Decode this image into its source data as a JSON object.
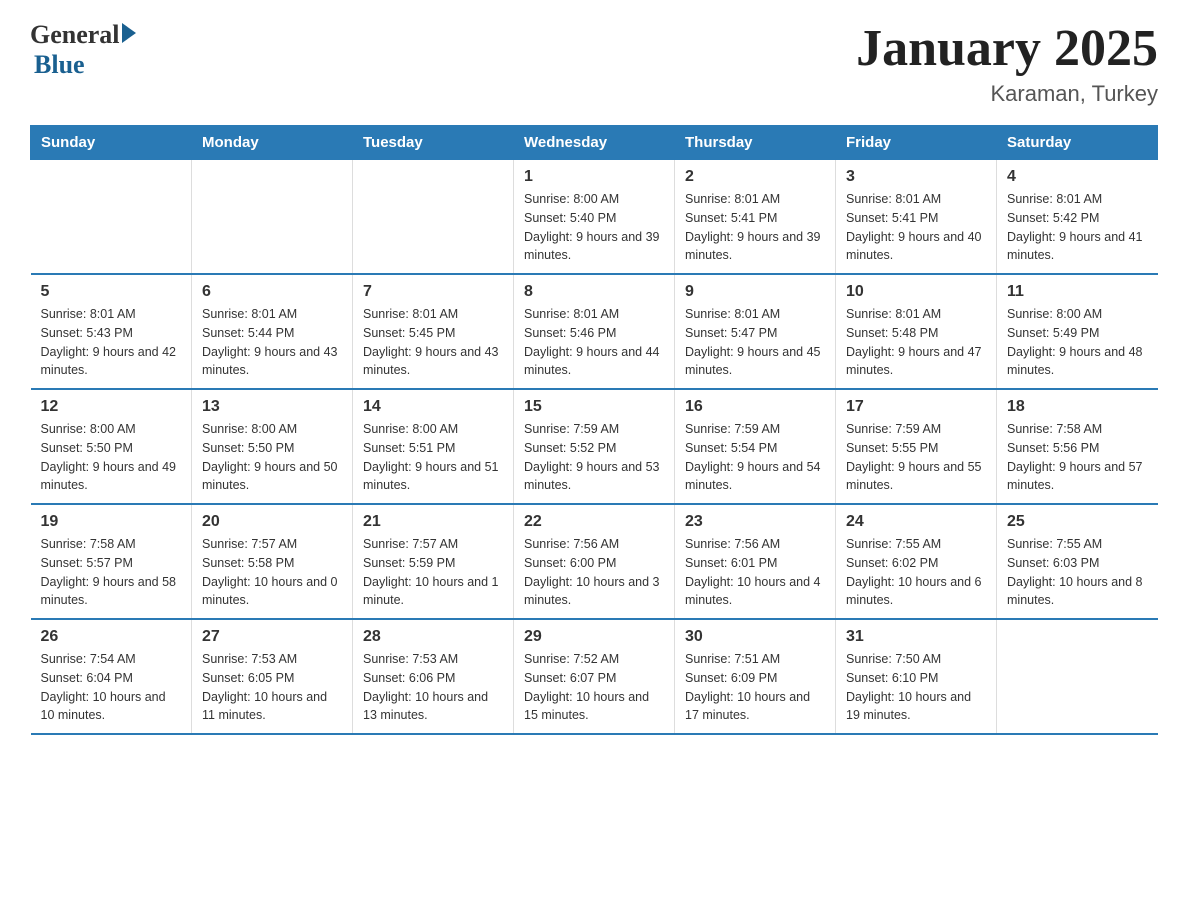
{
  "logo": {
    "general": "General",
    "blue": "Blue"
  },
  "title": "January 2025",
  "subtitle": "Karaman, Turkey",
  "weekdays": [
    "Sunday",
    "Monday",
    "Tuesday",
    "Wednesday",
    "Thursday",
    "Friday",
    "Saturday"
  ],
  "weeks": [
    [
      {
        "day": "",
        "info": ""
      },
      {
        "day": "",
        "info": ""
      },
      {
        "day": "",
        "info": ""
      },
      {
        "day": "1",
        "info": "Sunrise: 8:00 AM\nSunset: 5:40 PM\nDaylight: 9 hours and 39 minutes."
      },
      {
        "day": "2",
        "info": "Sunrise: 8:01 AM\nSunset: 5:41 PM\nDaylight: 9 hours and 39 minutes."
      },
      {
        "day": "3",
        "info": "Sunrise: 8:01 AM\nSunset: 5:41 PM\nDaylight: 9 hours and 40 minutes."
      },
      {
        "day": "4",
        "info": "Sunrise: 8:01 AM\nSunset: 5:42 PM\nDaylight: 9 hours and 41 minutes."
      }
    ],
    [
      {
        "day": "5",
        "info": "Sunrise: 8:01 AM\nSunset: 5:43 PM\nDaylight: 9 hours and 42 minutes."
      },
      {
        "day": "6",
        "info": "Sunrise: 8:01 AM\nSunset: 5:44 PM\nDaylight: 9 hours and 43 minutes."
      },
      {
        "day": "7",
        "info": "Sunrise: 8:01 AM\nSunset: 5:45 PM\nDaylight: 9 hours and 43 minutes."
      },
      {
        "day": "8",
        "info": "Sunrise: 8:01 AM\nSunset: 5:46 PM\nDaylight: 9 hours and 44 minutes."
      },
      {
        "day": "9",
        "info": "Sunrise: 8:01 AM\nSunset: 5:47 PM\nDaylight: 9 hours and 45 minutes."
      },
      {
        "day": "10",
        "info": "Sunrise: 8:01 AM\nSunset: 5:48 PM\nDaylight: 9 hours and 47 minutes."
      },
      {
        "day": "11",
        "info": "Sunrise: 8:00 AM\nSunset: 5:49 PM\nDaylight: 9 hours and 48 minutes."
      }
    ],
    [
      {
        "day": "12",
        "info": "Sunrise: 8:00 AM\nSunset: 5:50 PM\nDaylight: 9 hours and 49 minutes."
      },
      {
        "day": "13",
        "info": "Sunrise: 8:00 AM\nSunset: 5:50 PM\nDaylight: 9 hours and 50 minutes."
      },
      {
        "day": "14",
        "info": "Sunrise: 8:00 AM\nSunset: 5:51 PM\nDaylight: 9 hours and 51 minutes."
      },
      {
        "day": "15",
        "info": "Sunrise: 7:59 AM\nSunset: 5:52 PM\nDaylight: 9 hours and 53 minutes."
      },
      {
        "day": "16",
        "info": "Sunrise: 7:59 AM\nSunset: 5:54 PM\nDaylight: 9 hours and 54 minutes."
      },
      {
        "day": "17",
        "info": "Sunrise: 7:59 AM\nSunset: 5:55 PM\nDaylight: 9 hours and 55 minutes."
      },
      {
        "day": "18",
        "info": "Sunrise: 7:58 AM\nSunset: 5:56 PM\nDaylight: 9 hours and 57 minutes."
      }
    ],
    [
      {
        "day": "19",
        "info": "Sunrise: 7:58 AM\nSunset: 5:57 PM\nDaylight: 9 hours and 58 minutes."
      },
      {
        "day": "20",
        "info": "Sunrise: 7:57 AM\nSunset: 5:58 PM\nDaylight: 10 hours and 0 minutes."
      },
      {
        "day": "21",
        "info": "Sunrise: 7:57 AM\nSunset: 5:59 PM\nDaylight: 10 hours and 1 minute."
      },
      {
        "day": "22",
        "info": "Sunrise: 7:56 AM\nSunset: 6:00 PM\nDaylight: 10 hours and 3 minutes."
      },
      {
        "day": "23",
        "info": "Sunrise: 7:56 AM\nSunset: 6:01 PM\nDaylight: 10 hours and 4 minutes."
      },
      {
        "day": "24",
        "info": "Sunrise: 7:55 AM\nSunset: 6:02 PM\nDaylight: 10 hours and 6 minutes."
      },
      {
        "day": "25",
        "info": "Sunrise: 7:55 AM\nSunset: 6:03 PM\nDaylight: 10 hours and 8 minutes."
      }
    ],
    [
      {
        "day": "26",
        "info": "Sunrise: 7:54 AM\nSunset: 6:04 PM\nDaylight: 10 hours and 10 minutes."
      },
      {
        "day": "27",
        "info": "Sunrise: 7:53 AM\nSunset: 6:05 PM\nDaylight: 10 hours and 11 minutes."
      },
      {
        "day": "28",
        "info": "Sunrise: 7:53 AM\nSunset: 6:06 PM\nDaylight: 10 hours and 13 minutes."
      },
      {
        "day": "29",
        "info": "Sunrise: 7:52 AM\nSunset: 6:07 PM\nDaylight: 10 hours and 15 minutes."
      },
      {
        "day": "30",
        "info": "Sunrise: 7:51 AM\nSunset: 6:09 PM\nDaylight: 10 hours and 17 minutes."
      },
      {
        "day": "31",
        "info": "Sunrise: 7:50 AM\nSunset: 6:10 PM\nDaylight: 10 hours and 19 minutes."
      },
      {
        "day": "",
        "info": ""
      }
    ]
  ]
}
